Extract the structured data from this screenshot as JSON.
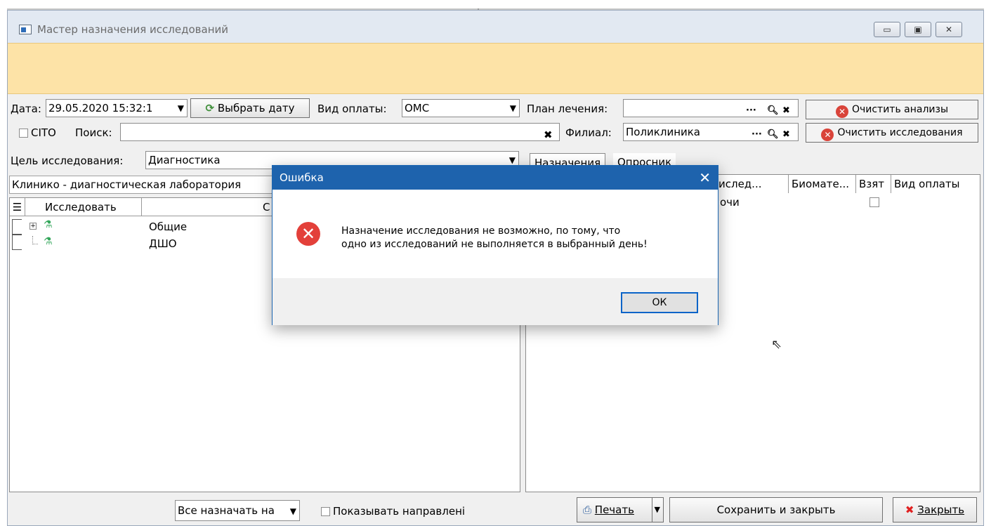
{
  "window": {
    "title": "Мастер назначения исследований"
  },
  "toolbar": {
    "date_label": "Дата:",
    "date_value": "29.05.2020 15:32:1",
    "choose_date_label": "Выбрать дату",
    "payment_label": "Вид оплаты:",
    "payment_value": "ОМС",
    "plan_label": "План лечения:",
    "plan_value": "",
    "clear_analyses_label": "Очистить анализы",
    "cito_label": "CITO",
    "search_label": "Поиск:",
    "search_value": "",
    "branch_label": "Филиал:",
    "branch_value": "Поликлиника",
    "clear_studies_label": "Очистить исследования",
    "purpose_label": "Цель исследования:",
    "purpose_value": "Диагностика",
    "lab_value": "Клинико - диагностическая лаборатория"
  },
  "left_panel": {
    "columns": [
      "Исследовать",
      "С"
    ],
    "rows": [
      {
        "name": "Общие"
      },
      {
        "name": "ДШО"
      }
    ]
  },
  "right_panel": {
    "tabs": [
      "Назначения",
      "Опросник"
    ],
    "columns": [
      "ислед...",
      "Биомате...",
      "Взят",
      "Вид оплаты"
    ],
    "rows": [
      {
        "study": "очи",
        "taken": false
      }
    ]
  },
  "footer": {
    "assign_all_label": "Все назначать на",
    "show_referrals_label": "Показывать направлені",
    "print_label": "Печать",
    "save_close_label": "Сохранить и закрыть",
    "close_label": "Закрыть"
  },
  "dialog": {
    "title": "Ошибка",
    "message_line1": "Назначение исследования не возможно, по тому, что",
    "message_line2": "одно из исследований не выполняется в выбранный день!",
    "ok_label": "ОК"
  }
}
